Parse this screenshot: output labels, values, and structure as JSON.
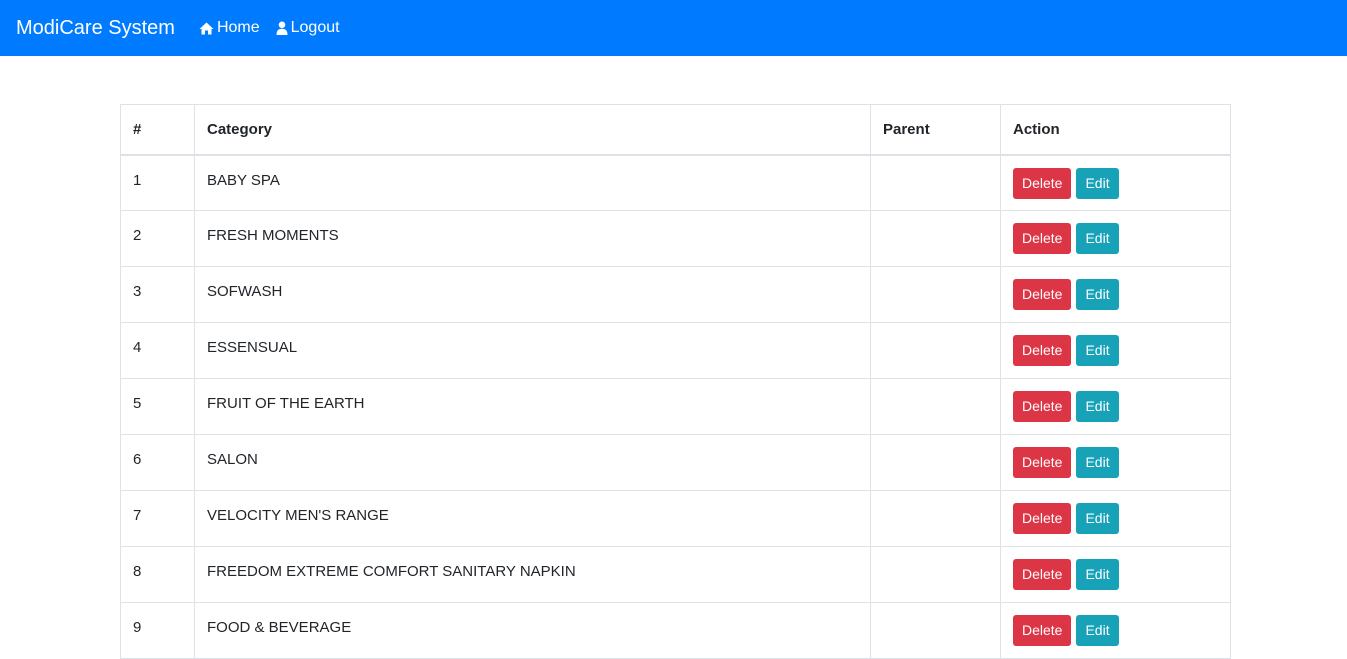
{
  "navbar": {
    "brand": "ModiCare System",
    "links": [
      {
        "label": "Home",
        "icon": "home-icon"
      },
      {
        "label": "Logout",
        "icon": "user-icon"
      }
    ]
  },
  "table": {
    "headers": [
      "#",
      "Category",
      "Parent",
      "Action"
    ],
    "rows": [
      {
        "num": "1",
        "category": "BABY SPA",
        "parent": ""
      },
      {
        "num": "2",
        "category": "FRESH MOMENTS",
        "parent": ""
      },
      {
        "num": "3",
        "category": "SOFWASH",
        "parent": ""
      },
      {
        "num": "4",
        "category": "ESSENSUAL",
        "parent": ""
      },
      {
        "num": "5",
        "category": "FRUIT OF THE EARTH",
        "parent": ""
      },
      {
        "num": "6",
        "category": "SALON",
        "parent": ""
      },
      {
        "num": "7",
        "category": "VELOCITY MEN'S RANGE",
        "parent": ""
      },
      {
        "num": "8",
        "category": "FREEDOM EXTREME COMFORT SANITARY NAPKIN",
        "parent": ""
      },
      {
        "num": "9",
        "category": "FOOD & BEVERAGE",
        "parent": ""
      }
    ],
    "delete_label": "Delete",
    "edit_label": "Edit"
  },
  "colors": {
    "navbar": "#007bff",
    "delete": "#dc3545",
    "edit": "#17a2b8"
  }
}
